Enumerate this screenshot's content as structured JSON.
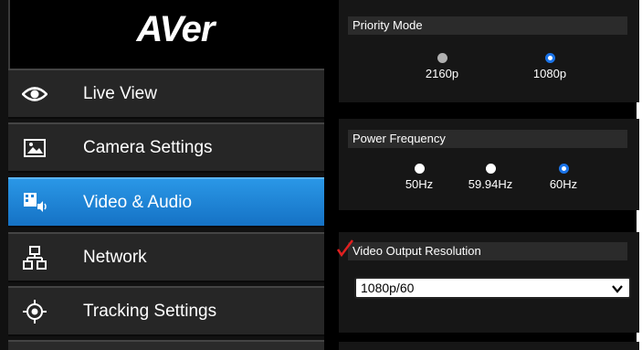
{
  "brand": {
    "logo_text": "AVer"
  },
  "sidebar": {
    "items": [
      {
        "label": "Live View",
        "icon": "eye-icon",
        "active": false
      },
      {
        "label": "Camera Settings",
        "icon": "image-icon",
        "active": false
      },
      {
        "label": "Video & Audio",
        "icon": "video-audio-icon",
        "active": true
      },
      {
        "label": "Network",
        "icon": "network-icon",
        "active": false
      },
      {
        "label": "Tracking Settings",
        "icon": "target-icon",
        "active": false
      }
    ]
  },
  "priority_mode": {
    "title": "Priority Mode",
    "options": [
      {
        "label": "2160p",
        "selected": false,
        "disabled": true
      },
      {
        "label": "1080p",
        "selected": true,
        "disabled": false
      }
    ]
  },
  "power_frequency": {
    "title": "Power Frequency",
    "options": [
      {
        "label": "50Hz",
        "selected": false
      },
      {
        "label": "59.94Hz",
        "selected": false
      },
      {
        "label": "60Hz",
        "selected": true
      }
    ]
  },
  "video_output": {
    "title": "Video Output Resolution",
    "value": "1080p/60"
  },
  "colors": {
    "accent": "#1a73e8",
    "active_nav": "#1e82d6",
    "checkmark": "#e02020"
  }
}
